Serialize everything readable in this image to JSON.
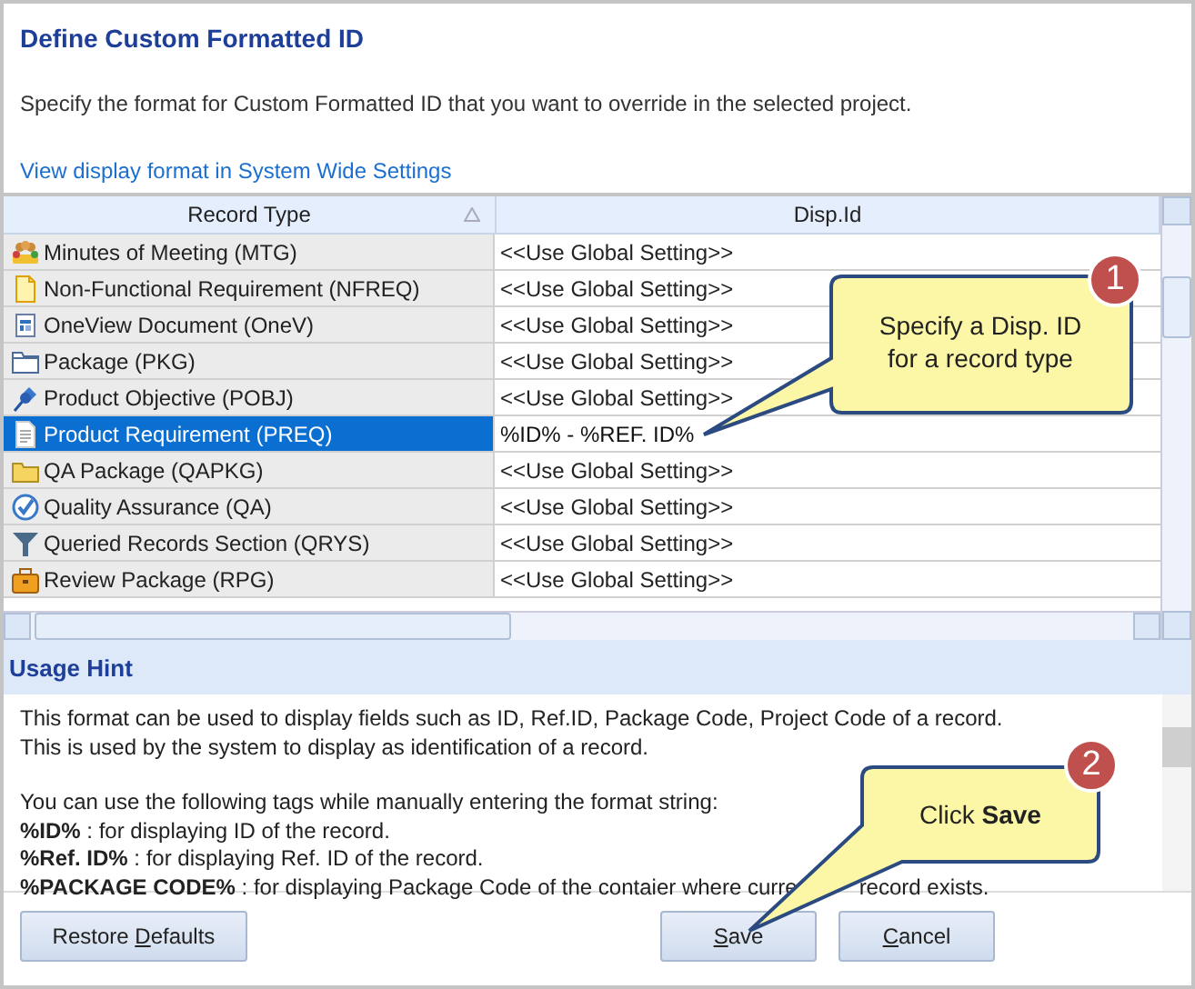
{
  "dialog": {
    "title": "Define Custom Formatted ID",
    "description": "Specify the format for Custom Formatted ID that you want to override in the selected project.",
    "link": "View display format in System Wide Settings"
  },
  "table": {
    "columns": [
      {
        "label": "Record Type",
        "sorted": true
      },
      {
        "label": "Disp.Id",
        "sorted": false
      }
    ],
    "rows": [
      {
        "kind": "meeting",
        "record_type": "Minutes of Meeting (MTG)",
        "disp_id": "<<Use Global Setting>>",
        "selected": false
      },
      {
        "kind": "note",
        "record_type": "Non-Functional Requirement (NFREQ)",
        "disp_id": "<<Use Global Setting>>",
        "selected": false
      },
      {
        "kind": "document",
        "record_type": "OneView Document (OneV)",
        "disp_id": "<<Use Global Setting>>",
        "selected": false
      },
      {
        "kind": "folder-outline",
        "record_type": "Package (PKG)",
        "disp_id": "<<Use Global Setting>>",
        "selected": false
      },
      {
        "kind": "pin",
        "record_type": "Product Objective (POBJ)",
        "disp_id": "<<Use Global Setting>>",
        "selected": false
      },
      {
        "kind": "page",
        "record_type": "Product Requirement (PREQ)",
        "disp_id": "%ID% - %REF. ID%",
        "selected": true
      },
      {
        "kind": "folder",
        "record_type": "QA Package (QAPKG)",
        "disp_id": "<<Use Global Setting>>",
        "selected": false
      },
      {
        "kind": "check",
        "record_type": "Quality Assurance (QA)",
        "disp_id": "<<Use Global Setting>>",
        "selected": false
      },
      {
        "kind": "funnel",
        "record_type": "Queried Records Section (QRYS)",
        "disp_id": "<<Use Global Setting>>",
        "selected": false
      },
      {
        "kind": "briefcase",
        "record_type": "Review Package (RPG)",
        "disp_id": "<<Use Global Setting>>",
        "selected": false
      }
    ]
  },
  "usage_hint": {
    "title": "Usage Hint",
    "paragraphs": [
      [
        "This format can be used to display fields such as ID, Ref.ID, Package Code, Project Code of a record.",
        "This is used by the system to display as identification of a record."
      ],
      [
        "You can use the following tags while manually entering the format string:",
        "**%ID%** : for displaying ID of the record.",
        "**%Ref. ID%** : for displaying Ref. ID of the record.",
        [
          "**%PACKAGE CODE%** : for displaying Package Code of the contaier where curre",
          "record exists."
        ]
      ]
    ]
  },
  "buttons": [
    {
      "kind": "left",
      "before": "Restore ",
      "key": "D",
      "after": "efaults"
    },
    {
      "kind": "right",
      "key": "S",
      "after": "ave"
    },
    {
      "kind": "right",
      "key": "C",
      "after": "ancel"
    }
  ],
  "callouts": [
    {
      "number": "1",
      "text": "Specify a Disp. ID for a record type"
    },
    {
      "number": "2",
      "text": "Click **Save**"
    }
  ]
}
